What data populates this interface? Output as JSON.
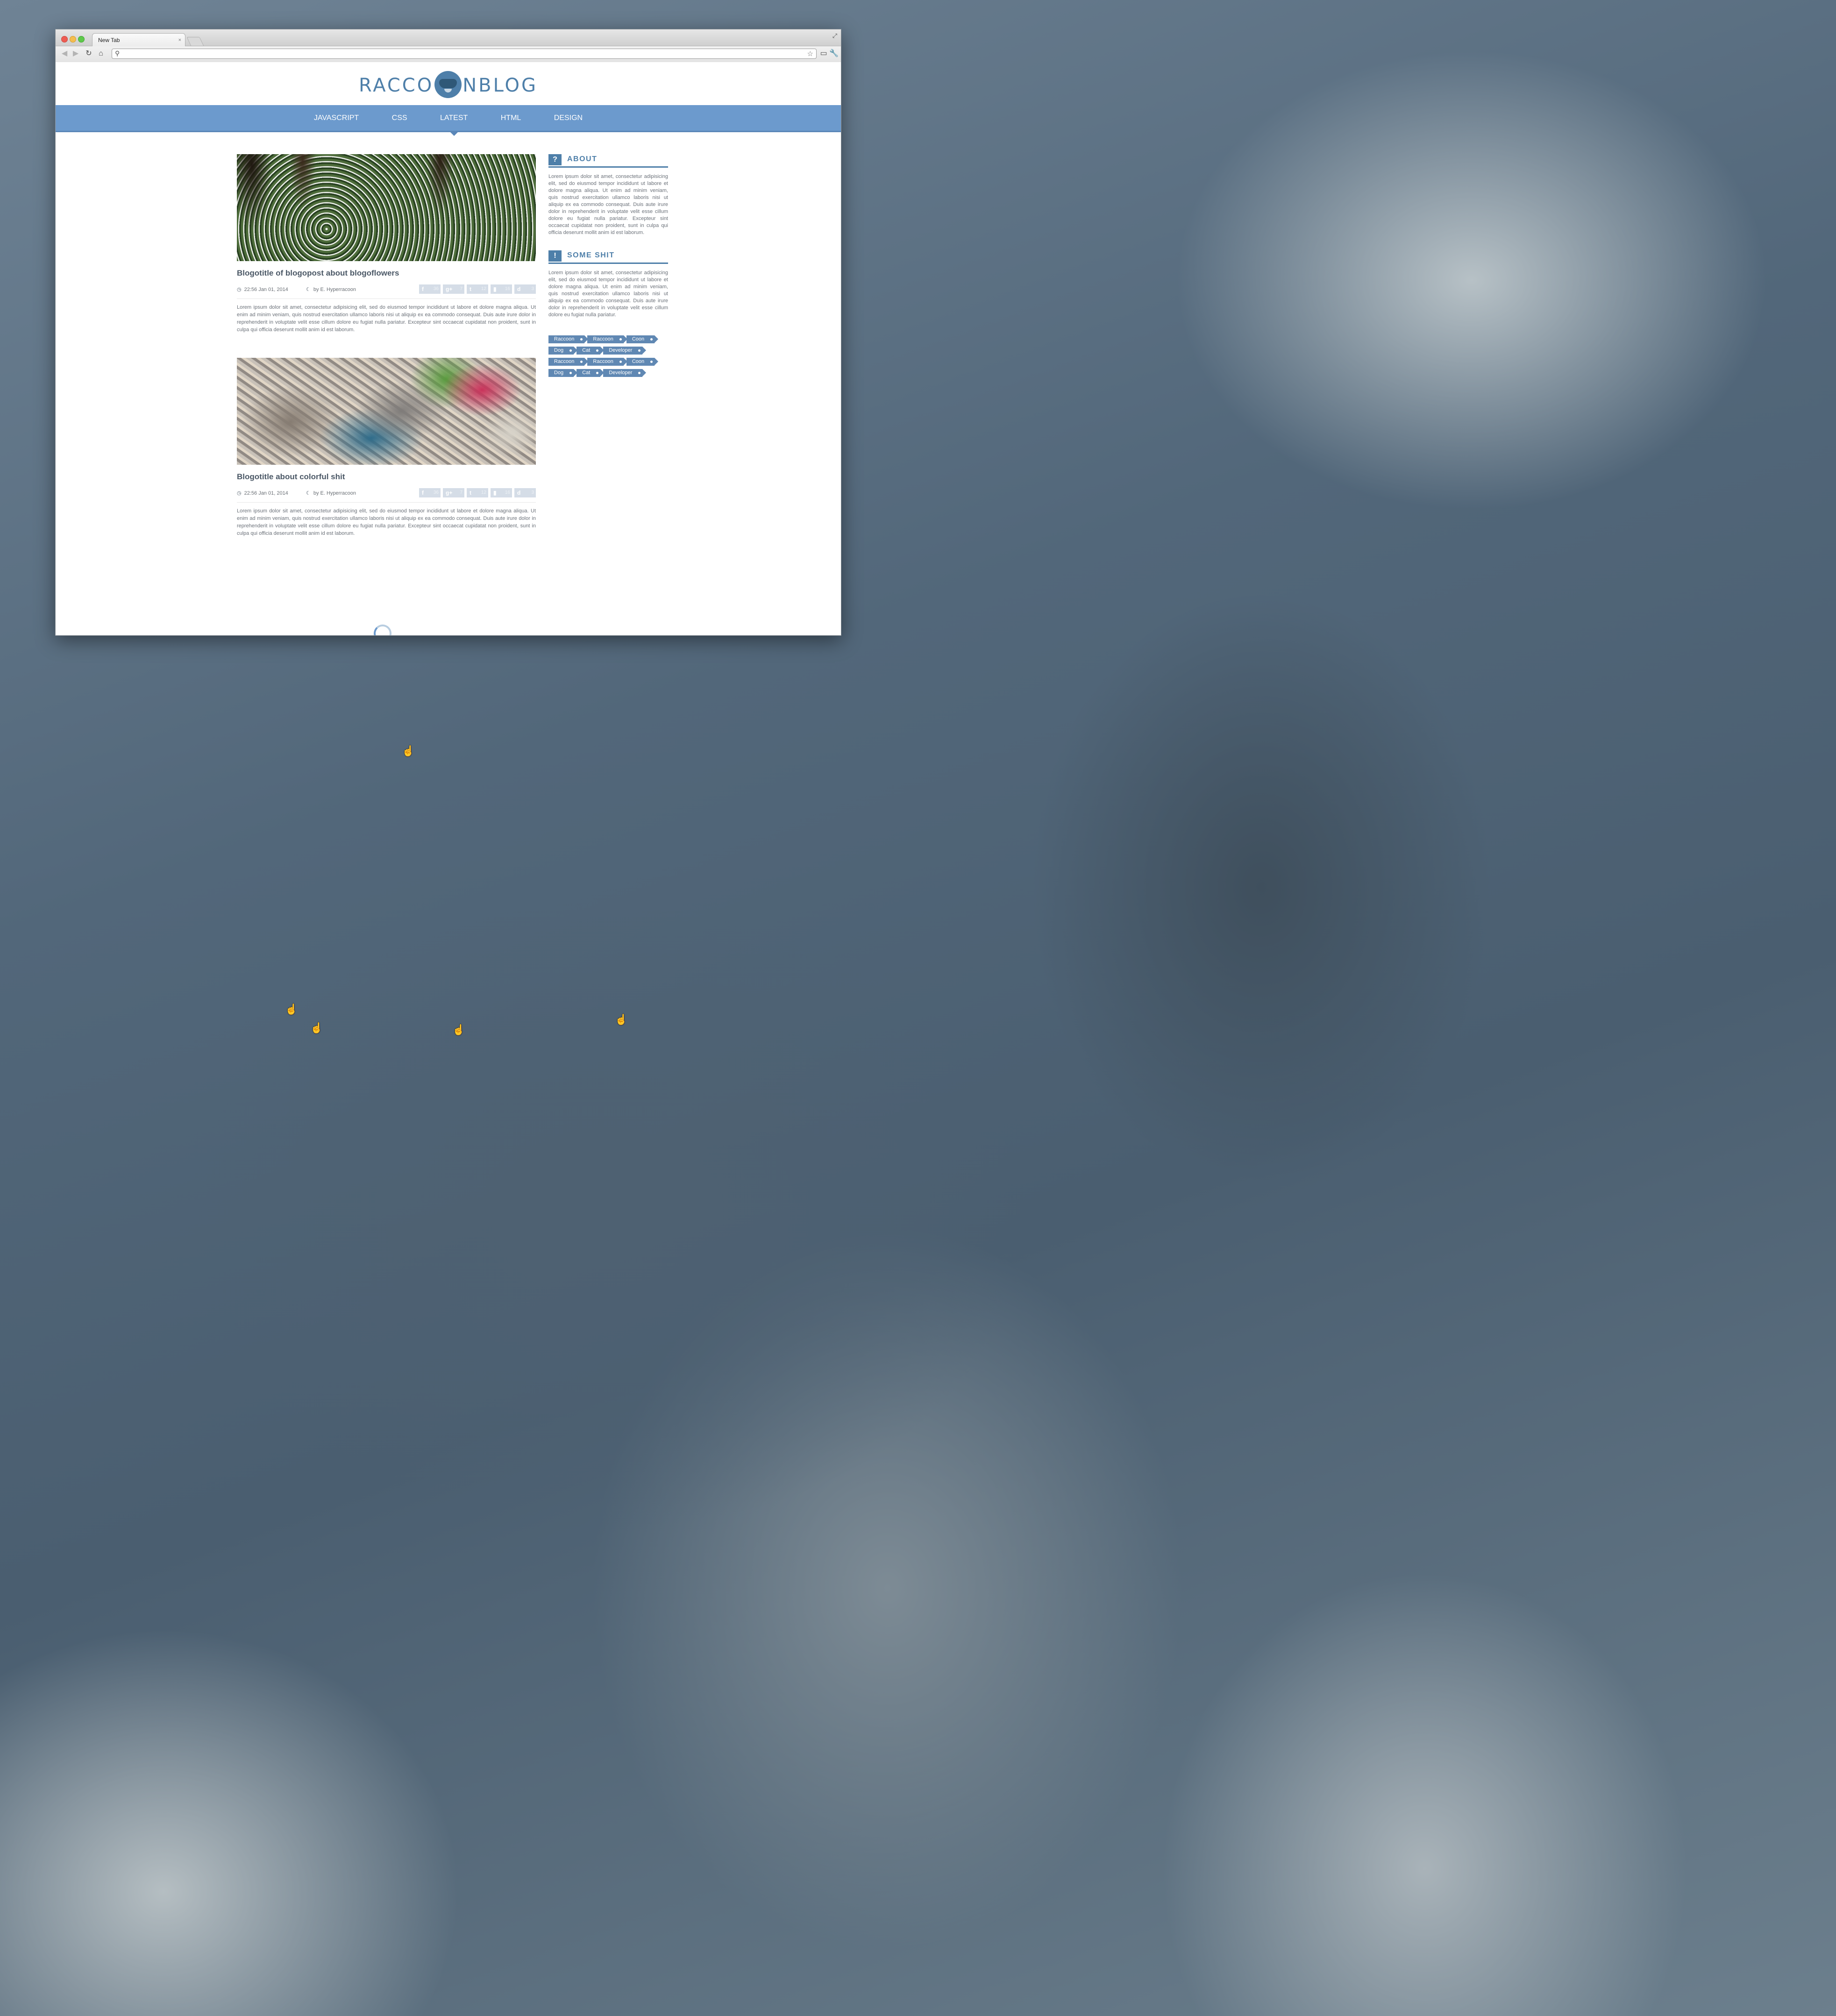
{
  "browser": {
    "tab_title": "New Tab",
    "tab_close": "×",
    "resize_icon": "⤢",
    "back_icon": "◀",
    "forward_icon": "▶",
    "reload_icon": "↻",
    "home_icon": "⌂",
    "search_icon": "⚲",
    "star_icon": "☆",
    "ext_icon": "▭",
    "wrench_icon": "🔧",
    "address_value": ""
  },
  "site": {
    "logo_left": "RACCO",
    "logo_right": "NBLOG",
    "nav": [
      "JAVASCRIPT",
      "CSS",
      "LATEST",
      "HTML",
      "DESIGN"
    ],
    "active_nav": "LATEST"
  },
  "posts": [
    {
      "title": "Blogotitle of blogopost about blogoflowers",
      "date": "22:56 Jan 01, 2014",
      "author": "by E. Hyperracoon",
      "excerpt": "Lorem ipsum dolor sit amet, consectetur adipisicing elit, sed do eiusmod tempor incididunt ut labore et dolore magna aliqua. Ut enim ad minim veniam, quis nostrud exercitation ullamco laboris nisi ut aliquip ex ea commodo consequat. Duis aute irure dolor in reprehenderit in voluptate velit esse cillum dolore eu fugiat nulla pariatur. Excepteur sint occaecat cupidatat non proident, sunt in culpa qui officia deserunt mollit anim id est laborum."
    },
    {
      "title": "Blogotitle about colorful shit",
      "date": "22:56 Jan 01, 2014",
      "author": "by E. Hyperracoon",
      "excerpt": "Lorem ipsum dolor sit amet, consectetur adipisicing elit, sed do eiusmod tempor incididunt ut labore et dolore magna aliqua. Ut enim ad minim veniam, quis nostrud exercitation ullamco laboris nisi ut aliquip ex ea commodo consequat. Duis aute irure dolor in reprehenderit in voluptate velit esse cillum dolore eu fugiat nulla pariatur. Excepteur sint occaecat cupidatat non proident, sunt in culpa qui officia deserunt mollit anim id est laborum."
    }
  ],
  "share_buttons": [
    {
      "glyph": "f",
      "count": "36"
    },
    {
      "glyph": "g+",
      "count": "7"
    },
    {
      "glyph": "t",
      "count": "12"
    },
    {
      "glyph": "▮",
      "count": "16"
    },
    {
      "glyph": "d",
      "count": "3"
    }
  ],
  "sidebar": {
    "about": {
      "icon": "?",
      "title": "ABOUT",
      "text": "Lorem ipsum dolor sit amet, consectetur adipisicing elit, sed do eiusmod tempor incididunt ut labore et dolore magna aliqua. Ut enim ad minim veniam, quis nostrud exercitation ullamco laboris nisi ut aliquip ex ea commodo consequat. Duis aute irure dolor in reprehenderit in voluptate velit esse cillum dolore eu fugiat nulla pariatur. Excepteur sint occaecat cupidatat non proident, sunt in culpa qui officia deserunt mollit anim id est laborum."
    },
    "some": {
      "icon": "!",
      "title": "SOME SHIT",
      "text": "Lorem ipsum dolor sit amet, consectetur adipisicing elit, sed do eiusmod tempor incididunt ut labore et dolore magna aliqua. Ut enim ad minim veniam, quis nostrud exercitation ullamco laboris nisi ut aliquip ex ea commodo consequat. Duis aute irure dolor in reprehenderit in voluptate velit esse cillum dolore eu fugiat nulla pariatur."
    },
    "tags": [
      [
        "Raccoon",
        "Raccoon",
        "Coon"
      ],
      [
        "Dog",
        "Cat",
        "Developer"
      ],
      [
        "Raccoon",
        "Raccoon",
        "Coon"
      ],
      [
        "Dog",
        "Cat",
        "Developer"
      ]
    ]
  },
  "colors": {
    "accent": "#4e7fa9",
    "nav_bg": "#6c9acd",
    "tag_bg": "#6088b3"
  },
  "cursor_icon": "☝"
}
